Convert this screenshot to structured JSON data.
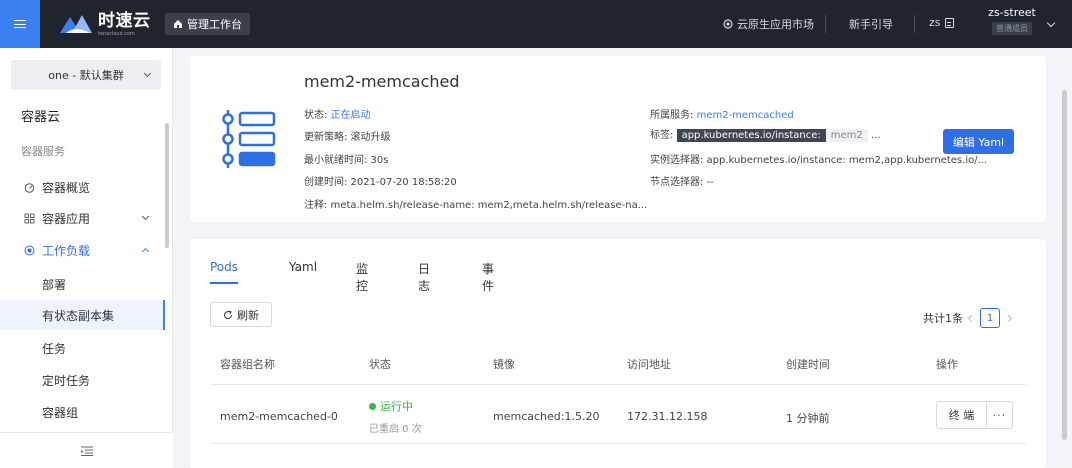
{
  "topbar": {
    "logo_name": "时速云",
    "logo_sub": "tenxcloud.com",
    "workbench": "管理工作台",
    "market": "云原生应用市场",
    "guide": "新手引导",
    "zs": "zs",
    "user_name": "zs-street",
    "user_role": "普通成员"
  },
  "sidebar": {
    "cluster": "one - 默认集群",
    "title": "容器云",
    "group": "容器服务",
    "items": [
      {
        "label": "容器概览",
        "icon": "dashboard-icon"
      },
      {
        "label": "容器应用",
        "icon": "apps-grid-icon"
      },
      {
        "label": "工作负载",
        "icon": "workload-icon"
      }
    ],
    "subitems": [
      "部署",
      "有状态副本集",
      "任务",
      "定时任务",
      "容器组"
    ],
    "active_subitem": "有状态副本集"
  },
  "detail": {
    "name": "mem2-memcached",
    "status_label": "状态:",
    "status_value": "正在启动",
    "update_strategy": "更新策略: 滚动升级",
    "min_ready": "最小就绪时间: 30s",
    "created": "创建时间: 2021-07-20 18:58:20",
    "annotation": "注释: meta.helm.sh/release-name: mem2,meta.helm.sh/release-na...",
    "service_label": "所属服务:",
    "service_value": "mem2-memcached",
    "tags_label": "标签:",
    "tag_key": "app.kubernetes.io/instance:",
    "tag_value": "mem2",
    "tag_more": "...",
    "selector": "实例选择器: app.kubernetes.io/instance: mem2,app.kubernetes.io/...",
    "node_selector": "节点选择器: --",
    "edit_yaml": "编辑 Yaml"
  },
  "tabs": [
    "Pods",
    "Yaml",
    "监控",
    "日志",
    "事件"
  ],
  "active_tab": "Pods",
  "toolbar": {
    "refresh": "刷新",
    "total": "共计1条",
    "page": "1"
  },
  "table": {
    "headers": [
      "容器组名称",
      "状态",
      "镜像",
      "访问地址",
      "创建时间",
      "操作"
    ],
    "rows": [
      {
        "name": "mem2-memcached-0",
        "status": "运行中",
        "restart": "已重启 0 次",
        "image": "memcached:1.5.20",
        "address": "172.31.12.158",
        "created": "1 分钟前",
        "action": "终 端",
        "more": "···"
      }
    ]
  },
  "colors": {
    "accent": "#2f6fe6",
    "topbar": "#20242c",
    "running": "#3ab54a"
  }
}
